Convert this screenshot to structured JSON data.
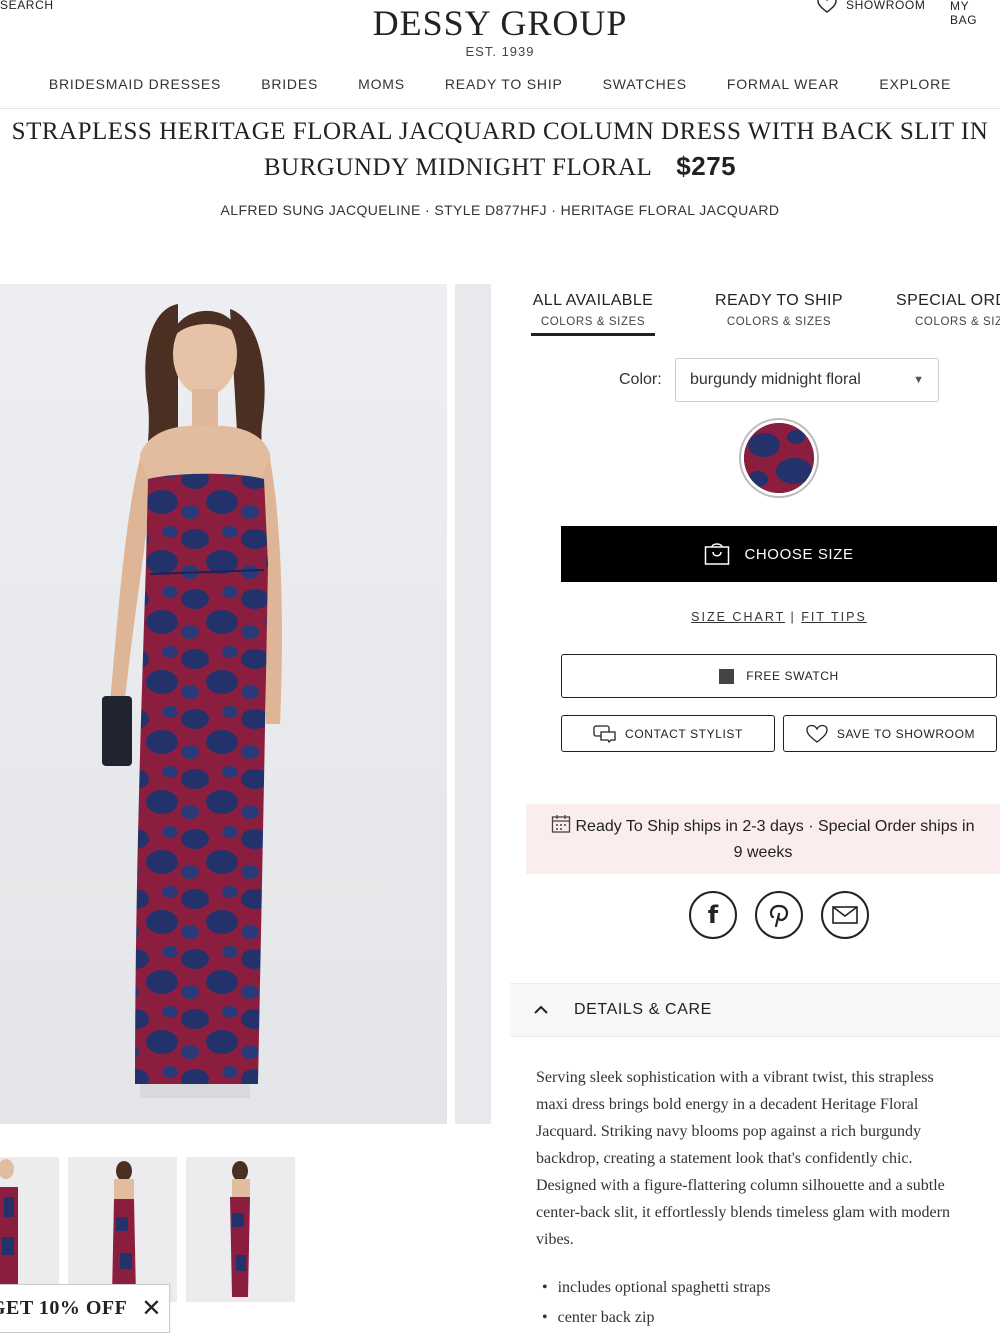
{
  "header": {
    "search_label": "SEARCH",
    "logo": "DESSY GROUP",
    "est": "EST. 1939",
    "showroom_label": "SHOWROOM",
    "bag_label": "MY BAG"
  },
  "nav": [
    "BRIDESMAID DRESSES",
    "BRIDES",
    "MOMS",
    "READY TO SHIP",
    "SWATCHES",
    "FORMAL WEAR",
    "EXPLORE"
  ],
  "product": {
    "title_line1": "STRAPLESS HERITAGE FLORAL JACQUARD COLUMN DRESS WITH BACK SLIT IN",
    "title_line2": "BURGUNDY MIDNIGHT FLORAL",
    "price": "$275",
    "subtitle": "ALFRED SUNG JACQUELINE · STYLE D877HFJ · HERITAGE FLORAL JACQUARD"
  },
  "tabs": [
    {
      "label": "ALL AVAILABLE",
      "sub": "COLORS & SIZES"
    },
    {
      "label": "READY TO SHIP",
      "sub": "COLORS & SIZES"
    },
    {
      "label": "SPECIAL ORDER",
      "sub": "COLORS & SIZES"
    }
  ],
  "color": {
    "label": "Color:",
    "selected": "burgundy midnight floral"
  },
  "buttons": {
    "choose_size": "CHOOSE SIZE",
    "size_chart": "SIZE CHART",
    "separator": "|",
    "fit_tips": "FIT TIPS",
    "free_swatch": "FREE SWATCH",
    "contact_stylist": "CONTACT STYLIST",
    "save_to_showroom": "SAVE TO SHOWROOM"
  },
  "shipping": {
    "line1": "Ready To Ship ships in 2-3 days · Special Order ships in",
    "line2": "9 weeks"
  },
  "details": {
    "heading": "DETAILS & CARE",
    "paragraph_lines": [
      "Serving sleek sophistication with a vibrant twist, this strapless",
      "maxi dress brings bold energy in a decadent Heritage Floral",
      "Jacquard. Striking navy blooms pop against a rich burgundy",
      "backdrop, creating a statement look that's confidently chic.",
      "Designed with a figure-flattering column silhouette and a subtle",
      "center-back slit, it effortlessly blends timeless glam with modern",
      "vibes."
    ],
    "bullets": [
      "includes optional spaghetti straps",
      "center back zip"
    ]
  },
  "promo": {
    "text": "GET 10% OFF"
  },
  "colors": {
    "burgundy": "#8b1e3f",
    "navy": "#23326b",
    "banner_bg": "#fbeced"
  }
}
